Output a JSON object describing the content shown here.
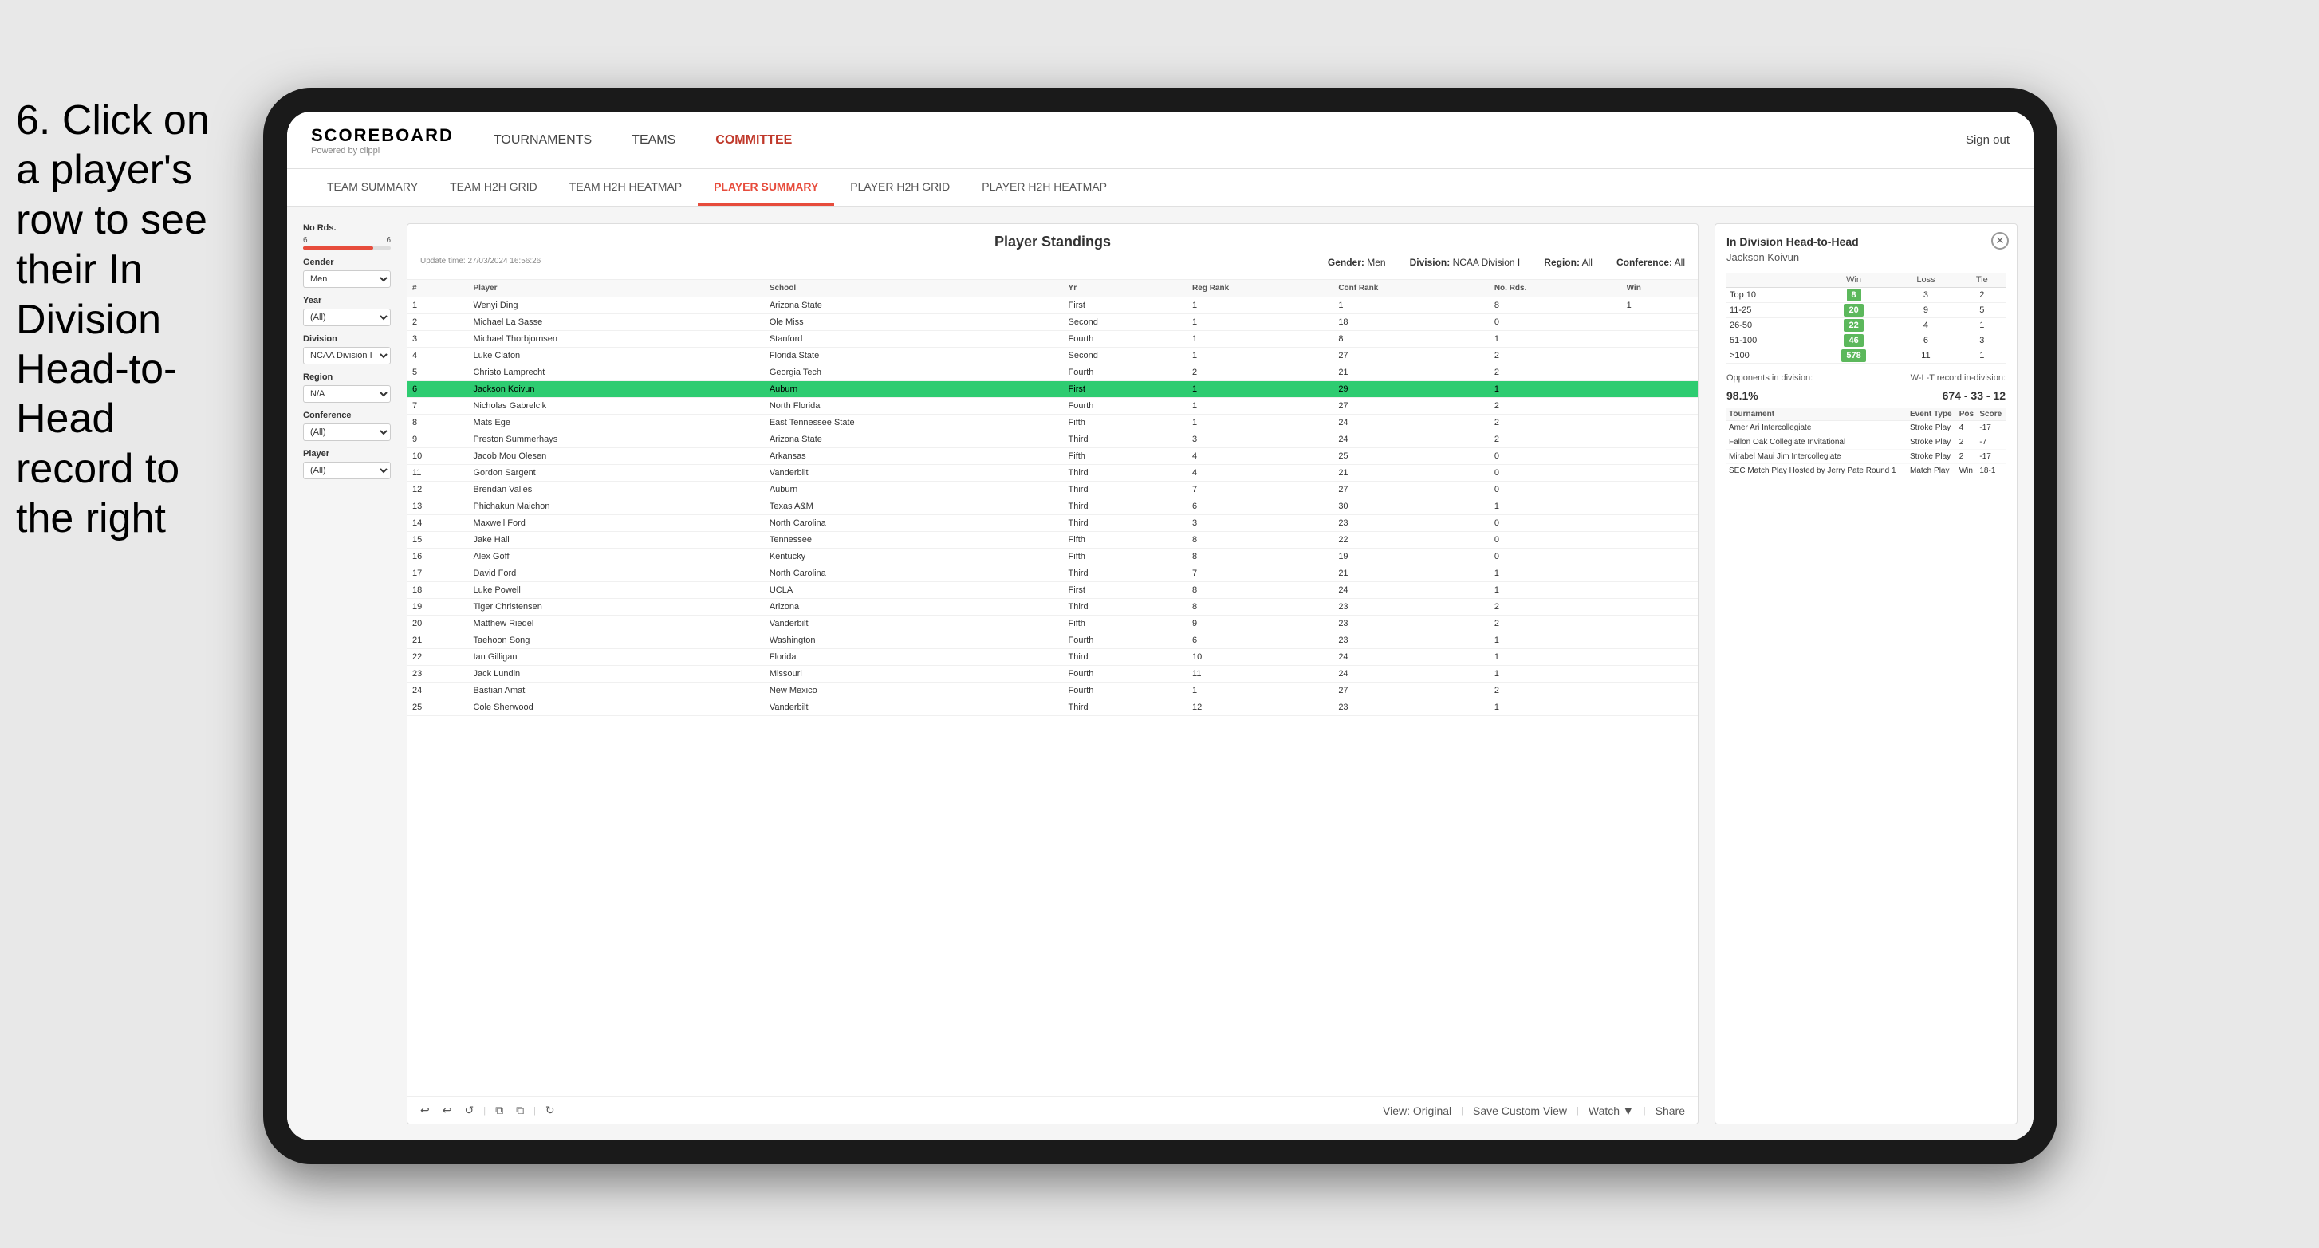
{
  "instruction": {
    "text": "6. Click on a player's row to see their In Division Head-to-Head record to the right"
  },
  "nav": {
    "logo": "SCOREBOARD",
    "logo_sub": "Powered by clippi",
    "items": [
      "TOURNAMENTS",
      "TEAMS",
      "COMMITTEE"
    ],
    "active_item": "COMMITTEE",
    "sign_out": "Sign out"
  },
  "sub_nav": {
    "items": [
      "TEAM SUMMARY",
      "TEAM H2H GRID",
      "TEAM H2H HEATMAP",
      "PLAYER SUMMARY",
      "PLAYER H2H GRID",
      "PLAYER H2H HEATMAP"
    ],
    "active": "PLAYER SUMMARY"
  },
  "filters": {
    "no_rds_label": "No Rds.",
    "no_rds_min": "6",
    "no_rds_max": "6",
    "gender_label": "Gender",
    "gender_value": "Men",
    "year_label": "Year",
    "year_value": "(All)",
    "division_label": "Division",
    "division_value": "NCAA Division I",
    "region_label": "Region",
    "region_value": "N/A",
    "conference_label": "Conference",
    "conference_value": "(All)",
    "player_label": "Player",
    "player_value": "(All)"
  },
  "standings": {
    "title": "Player Standings",
    "update_label": "Update time:",
    "update_time": "27/03/2024 16:56:26",
    "gender_label": "Gender:",
    "gender_value": "Men",
    "division_label": "Division:",
    "division_value": "NCAA Division I",
    "region_label": "Region:",
    "region_value": "All",
    "conference_label": "Conference:",
    "conference_value": "All",
    "columns": [
      "#",
      "Player",
      "School",
      "Yr",
      "Reg Rank",
      "Conf Rank",
      "No. Rds.",
      "Win"
    ],
    "rows": [
      {
        "num": 1,
        "player": "Wenyi Ding",
        "school": "Arizona State",
        "yr": "First",
        "reg": 1,
        "conf": 1,
        "rds": 8,
        "win": 1
      },
      {
        "num": 2,
        "player": "Michael La Sasse",
        "school": "Ole Miss",
        "yr": "Second",
        "reg": 1,
        "conf": 18,
        "rds": 0
      },
      {
        "num": 3,
        "player": "Michael Thorbjornsen",
        "school": "Stanford",
        "yr": "Fourth",
        "reg": 1,
        "conf": 8,
        "rds": 1
      },
      {
        "num": 4,
        "player": "Luke Claton",
        "school": "Florida State",
        "yr": "Second",
        "reg": 1,
        "conf": 27,
        "rds": 2
      },
      {
        "num": 5,
        "player": "Christo Lamprecht",
        "school": "Georgia Tech",
        "yr": "Fourth",
        "reg": 2,
        "conf": 21,
        "rds": 2
      },
      {
        "num": 6,
        "player": "Jackson Koivun",
        "school": "Auburn",
        "yr": "First",
        "reg": 1,
        "conf": 29,
        "rds": 1,
        "selected": true
      },
      {
        "num": 7,
        "player": "Nicholas Gabrelcik",
        "school": "North Florida",
        "yr": "Fourth",
        "reg": 1,
        "conf": 27,
        "rds": 2
      },
      {
        "num": 8,
        "player": "Mats Ege",
        "school": "East Tennessee State",
        "yr": "Fifth",
        "reg": 1,
        "conf": 24,
        "rds": 2
      },
      {
        "num": 9,
        "player": "Preston Summerhays",
        "school": "Arizona State",
        "yr": "Third",
        "reg": 3,
        "conf": 24,
        "rds": 2
      },
      {
        "num": 10,
        "player": "Jacob Mou Olesen",
        "school": "Arkansas",
        "yr": "Fifth",
        "reg": 4,
        "conf": 25,
        "rds": 0
      },
      {
        "num": 11,
        "player": "Gordon Sargent",
        "school": "Vanderbilt",
        "yr": "Third",
        "reg": 4,
        "conf": 21,
        "rds": 0
      },
      {
        "num": 12,
        "player": "Brendan Valles",
        "school": "Auburn",
        "yr": "Third",
        "reg": 7,
        "conf": 27,
        "rds": 0
      },
      {
        "num": 13,
        "player": "Phichakun Maichon",
        "school": "Texas A&M",
        "yr": "Third",
        "reg": 6,
        "conf": 30,
        "rds": 1
      },
      {
        "num": 14,
        "player": "Maxwell Ford",
        "school": "North Carolina",
        "yr": "Third",
        "reg": 3,
        "conf": 23,
        "rds": 0
      },
      {
        "num": 15,
        "player": "Jake Hall",
        "school": "Tennessee",
        "yr": "Fifth",
        "reg": 8,
        "conf": 22,
        "rds": 0
      },
      {
        "num": 16,
        "player": "Alex Goff",
        "school": "Kentucky",
        "yr": "Fifth",
        "reg": 8,
        "conf": 19,
        "rds": 0
      },
      {
        "num": 17,
        "player": "David Ford",
        "school": "North Carolina",
        "yr": "Third",
        "reg": 7,
        "conf": 21,
        "rds": 1
      },
      {
        "num": 18,
        "player": "Luke Powell",
        "school": "UCLA",
        "yr": "First",
        "reg": 8,
        "conf": 24,
        "rds": 1
      },
      {
        "num": 19,
        "player": "Tiger Christensen",
        "school": "Arizona",
        "yr": "Third",
        "reg": 8,
        "conf": 23,
        "rds": 2
      },
      {
        "num": 20,
        "player": "Matthew Riedel",
        "school": "Vanderbilt",
        "yr": "Fifth",
        "reg": 9,
        "conf": 23,
        "rds": 2
      },
      {
        "num": 21,
        "player": "Taehoon Song",
        "school": "Washington",
        "yr": "Fourth",
        "reg": 6,
        "conf": 23,
        "rds": 1
      },
      {
        "num": 22,
        "player": "Ian Gilligan",
        "school": "Florida",
        "yr": "Third",
        "reg": 10,
        "conf": 24,
        "rds": 1
      },
      {
        "num": 23,
        "player": "Jack Lundin",
        "school": "Missouri",
        "yr": "Fourth",
        "reg": 11,
        "conf": 24,
        "rds": 1
      },
      {
        "num": 24,
        "player": "Bastian Amat",
        "school": "New Mexico",
        "yr": "Fourth",
        "reg": 1,
        "conf": 27,
        "rds": 2
      },
      {
        "num": 25,
        "player": "Cole Sherwood",
        "school": "Vanderbilt",
        "yr": "Third",
        "reg": 12,
        "conf": 23,
        "rds": 1
      }
    ]
  },
  "h2h": {
    "title": "In Division Head-to-Head",
    "player": "Jackson Koivun",
    "columns": [
      "Win",
      "Loss",
      "Tie"
    ],
    "rows": [
      {
        "rank": "Top 10",
        "win": 8,
        "loss": 3,
        "tie": 2
      },
      {
        "rank": "11-25",
        "win": 20,
        "loss": 9,
        "tie": 5
      },
      {
        "rank": "26-50",
        "win": 22,
        "loss": 4,
        "tie": 1
      },
      {
        "rank": "51-100",
        "win": 46,
        "loss": 6,
        "tie": 3
      },
      {
        "rank": ">100",
        "win": 578,
        "loss": 11,
        "tie": 1
      }
    ],
    "opponents_label": "Opponents in division:",
    "wl_label": "W-L-T record in-division:",
    "opponents_pct": "98.1%",
    "wl_record": "674 - 33 - 12",
    "tournament_columns": [
      "Tournament",
      "Event Type",
      "Pos",
      "Score"
    ],
    "tournaments": [
      {
        "name": "Amer Ari Intercollegiate",
        "type": "Stroke Play",
        "pos": 4,
        "score": "-17"
      },
      {
        "name": "Fallon Oak Collegiate Invitational",
        "type": "Stroke Play",
        "pos": 2,
        "score": "-7"
      },
      {
        "name": "Mirabel Maui Jim Intercollegiate",
        "type": "Stroke Play",
        "pos": 2,
        "score": "-17"
      },
      {
        "name": "SEC Match Play Hosted by Jerry Pate Round 1",
        "type": "Match Play",
        "pos": "Win",
        "score": "18-1"
      }
    ]
  },
  "toolbar": {
    "view_original": "View: Original",
    "save_custom": "Save Custom View",
    "watch": "Watch ▼",
    "share": "Share"
  }
}
